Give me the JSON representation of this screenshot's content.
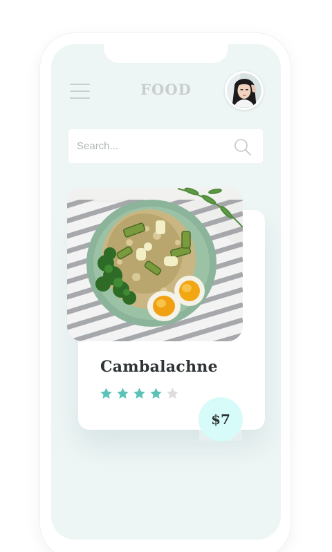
{
  "header": {
    "title": "FOOD",
    "menu_icon": "hamburger-menu-icon",
    "avatar_icon": "user-avatar"
  },
  "search": {
    "placeholder": "Search...",
    "value": "",
    "icon": "search-icon"
  },
  "card": {
    "name": "Cambalachne",
    "image": "plate of rice with zucchini, leeks, parsley and boiled eggs",
    "rating": 4,
    "rating_max": 5,
    "price": "$7"
  },
  "colors": {
    "screen_bg": "#eef5f5",
    "star_filled": "#5cc2b8",
    "star_empty": "#dddddd",
    "price_badge": "#d6fbf8",
    "title": "#c9cdcd",
    "text_dark": "#2f3335"
  }
}
